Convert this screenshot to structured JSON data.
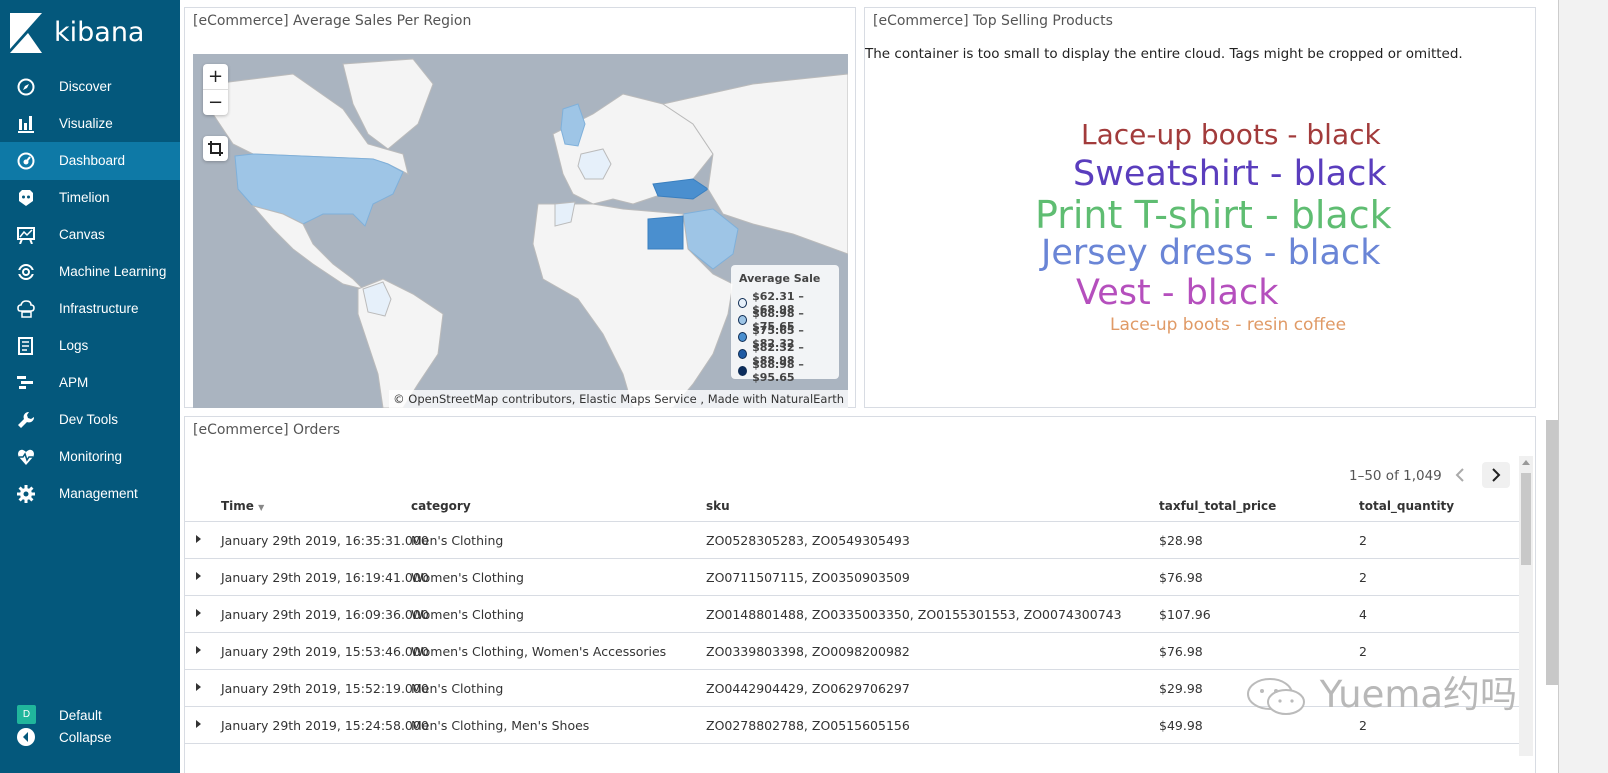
{
  "app": {
    "logo_text": "kibana"
  },
  "sidebar": {
    "items": [
      {
        "label": "Discover",
        "icon": "compass-icon"
      },
      {
        "label": "Visualize",
        "icon": "bar-chart-icon"
      },
      {
        "label": "Dashboard",
        "icon": "dashboard-icon",
        "active": true
      },
      {
        "label": "Timelion",
        "icon": "timelion-icon"
      },
      {
        "label": "Canvas",
        "icon": "canvas-icon"
      },
      {
        "label": "Machine Learning",
        "icon": "ml-icon"
      },
      {
        "label": "Infrastructure",
        "icon": "infrastructure-icon"
      },
      {
        "label": "Logs",
        "icon": "logs-icon"
      },
      {
        "label": "APM",
        "icon": "apm-icon"
      },
      {
        "label": "Dev Tools",
        "icon": "wrench-icon"
      },
      {
        "label": "Monitoring",
        "icon": "heartbeat-icon"
      },
      {
        "label": "Management",
        "icon": "gear-icon"
      }
    ],
    "space_badge": "D",
    "space_label": "Default",
    "collapse_label": "Collapse"
  },
  "map_panel": {
    "title": "[eCommerce] Average Sales Per Region",
    "zoom_in": "+",
    "zoom_out": "−",
    "legend_title": "Average Sale",
    "legend_items": [
      {
        "label": "$62.31 – $68.98",
        "color": "#e6f0fa"
      },
      {
        "label": "$68.98 – $75.65",
        "color": "#9ec5e6"
      },
      {
        "label": "$75.65 – $82.32",
        "color": "#4a8fcf"
      },
      {
        "label": "$82.32 – $88.98",
        "color": "#1e5aa3"
      },
      {
        "label": "$88.98 – $95.65",
        "color": "#0b2c5c"
      }
    ],
    "attribution": "© OpenStreetMap contributors, Elastic Maps Service , Made with NaturalEarth"
  },
  "cloud_panel": {
    "title": "[eCommerce] Top Selling Products",
    "message": "The container is too small to display the entire cloud. Tags might be cropped or omitted.",
    "tags": [
      {
        "text": "Lace-up boots - black",
        "color": "#a23b3b"
      },
      {
        "text": "Sweatshirt - black",
        "color": "#5a3dbd"
      },
      {
        "text": "Print T-shirt - black",
        "color": "#5fbd72"
      },
      {
        "text": "Jersey dress - black",
        "color": "#6a85d6"
      },
      {
        "text": "Vest - black",
        "color": "#b54fbd"
      },
      {
        "text": "Lace-up boots - resin coffee",
        "color": "#e09a66"
      }
    ]
  },
  "orders_panel": {
    "title": "[eCommerce] Orders",
    "pager": "1–50 of 1,049",
    "columns": [
      "Time",
      "category",
      "sku",
      "taxful_total_price",
      "total_quantity"
    ],
    "rows": [
      {
        "time": "January 29th 2019, 16:35:31.000",
        "category": "Men's Clothing",
        "sku": "ZO0528305283, ZO0549305493",
        "price": "$28.98",
        "qty": "2"
      },
      {
        "time": "January 29th 2019, 16:19:41.000",
        "category": "Women's Clothing",
        "sku": "ZO0711507115, ZO0350903509",
        "price": "$76.98",
        "qty": "2"
      },
      {
        "time": "January 29th 2019, 16:09:36.000",
        "category": "Women's Clothing",
        "sku": "ZO0148801488, ZO0335003350, ZO0155301553, ZO0074300743",
        "price": "$107.96",
        "qty": "4"
      },
      {
        "time": "January 29th 2019, 15:53:46.000",
        "category": "Women's Clothing, Women's Accessories",
        "sku": "ZO0339803398, ZO0098200982",
        "price": "$76.98",
        "qty": "2"
      },
      {
        "time": "January 29th 2019, 15:52:19.000",
        "category": "Men's Clothing",
        "sku": "ZO0442904429, ZO0629706297",
        "price": "$29.98",
        "qty": ""
      },
      {
        "time": "January 29th 2019, 15:24:58.000",
        "category": "Men's Clothing, Men's Shoes",
        "sku": "ZO0278802788, ZO0515605156",
        "price": "$49.98",
        "qty": "2"
      }
    ]
  },
  "watermark": "Yuema约吗"
}
